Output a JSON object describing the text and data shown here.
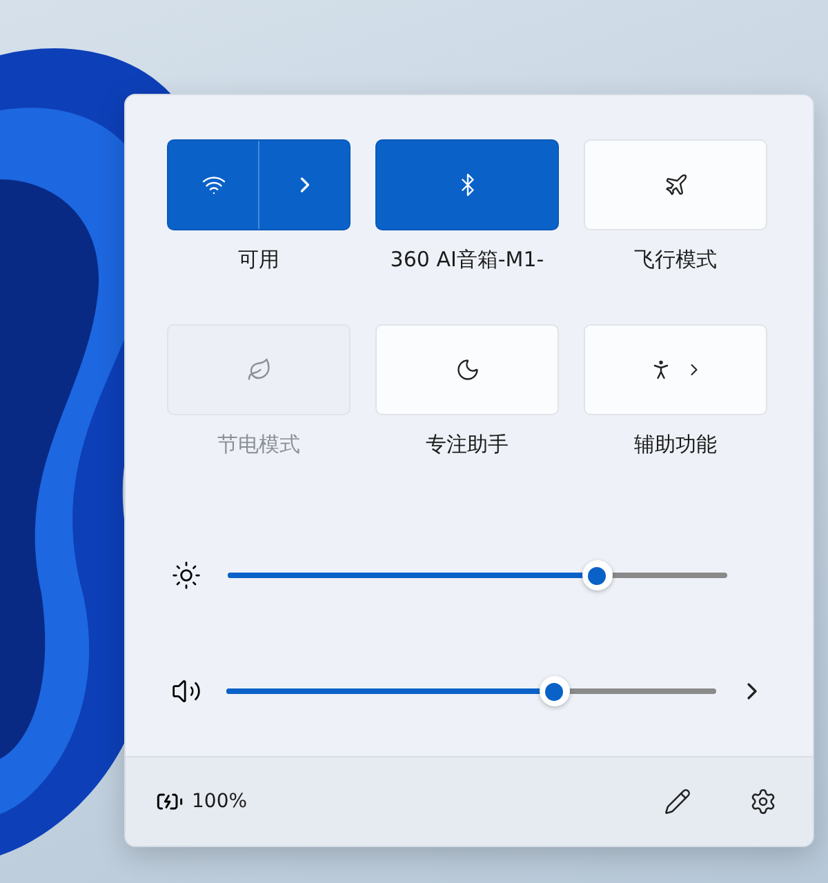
{
  "tiles": [
    {
      "kind": "split",
      "label": "可用",
      "on": true,
      "disabled": false
    },
    {
      "kind": "plain",
      "label": "360 AI音箱-M1-",
      "on": true,
      "disabled": false
    },
    {
      "kind": "plain",
      "label": "飞行模式",
      "on": false,
      "disabled": false
    },
    {
      "kind": "plain",
      "label": "节电模式",
      "on": false,
      "disabled": true
    },
    {
      "kind": "plain",
      "label": "专注助手",
      "on": false,
      "disabled": false
    },
    {
      "kind": "expand",
      "label": "辅助功能",
      "on": false,
      "disabled": false
    }
  ],
  "sliders": [
    {
      "kind": "brightness",
      "level": 0.74
    },
    {
      "kind": "volume",
      "level": 0.67
    }
  ],
  "footer": {
    "battery": "100%"
  }
}
